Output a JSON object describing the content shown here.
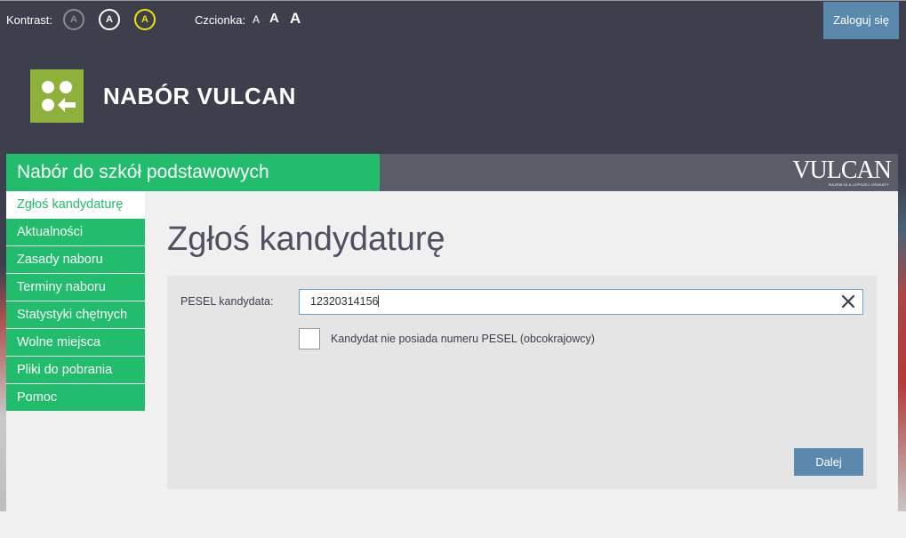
{
  "topbar": {
    "contrast_label": "Kontrast:",
    "contrast_options": [
      "A",
      "A",
      "A"
    ],
    "font_label": "Czcionka:",
    "font_options": [
      "A",
      "A",
      "A"
    ],
    "login_label": "Zaloguj się"
  },
  "header": {
    "app_title": "NABÓR VULCAN",
    "section_title": "Nabór do szkół podstawowych",
    "brand": "VULCAN",
    "brand_tagline": "RAZEM DLA LEPSZEJ OŚWIATY"
  },
  "sidebar": {
    "items": [
      {
        "label": "Zgłoś kandydaturę",
        "active": true
      },
      {
        "label": "Aktualności"
      },
      {
        "label": "Zasady naboru"
      },
      {
        "label": "Terminy naboru"
      },
      {
        "label": "Statystyki chętnych"
      },
      {
        "label": "Wolne miejsca"
      },
      {
        "label": "Pliki do pobrania"
      },
      {
        "label": "Pomoc"
      }
    ]
  },
  "main": {
    "page_title": "Zgłoś kandydaturę",
    "form": {
      "pesel_label": "PESEL kandydata:",
      "pesel_value": "12320314156",
      "no_pesel_label": "Kandydat nie posiada numeru PESEL (obcokrajowcy)",
      "no_pesel_checked": false,
      "next_label": "Dalej"
    }
  },
  "colors": {
    "header_bg": "#3d3f4c",
    "accent_green": "#22bd6c",
    "logo_green": "#8eb13c",
    "button_blue": "#5b88ad"
  },
  "icons": [
    "clear-icon",
    "logo-icon"
  ]
}
